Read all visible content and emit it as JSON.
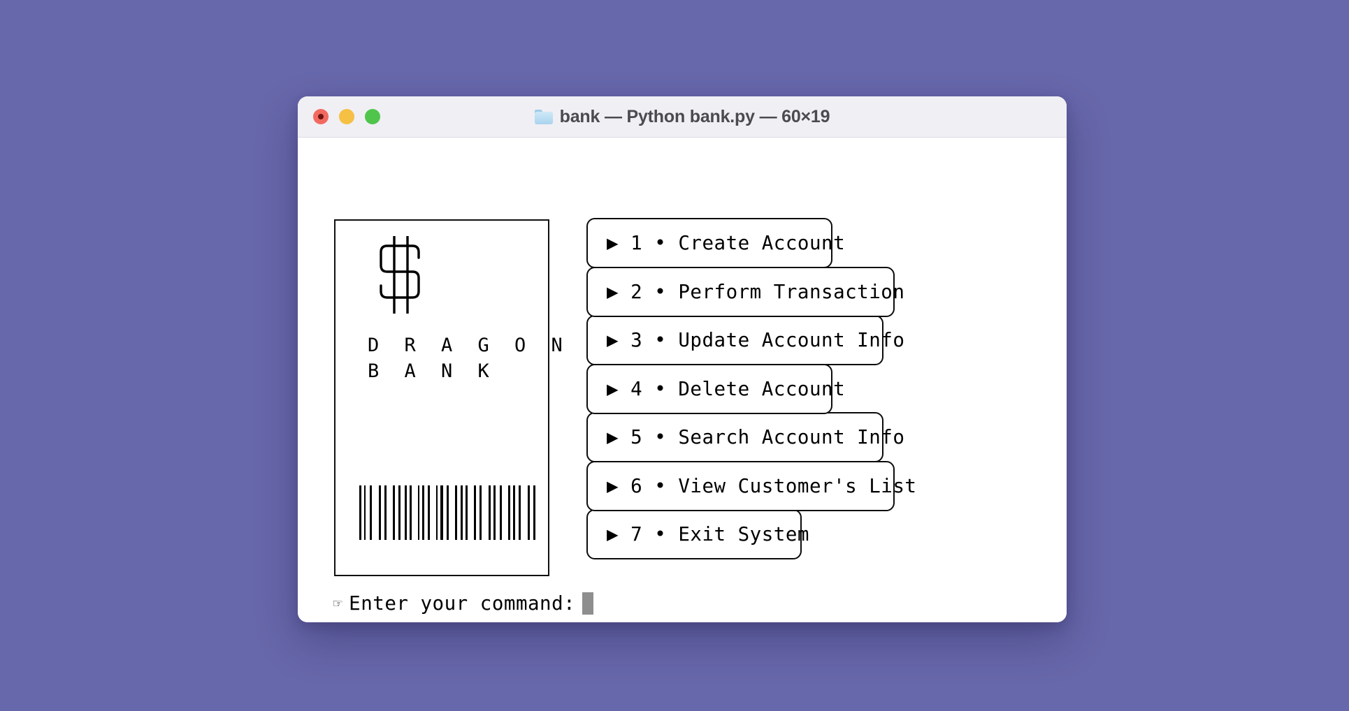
{
  "desktop": {
    "background_color": "#6767ab"
  },
  "window": {
    "title": "bank — Python bank.py — 60×19",
    "folder_icon": "folder-icon",
    "titlebar_color": "#f0eff4",
    "body_color": "#ffffff",
    "traffic_lights": [
      {
        "name": "close",
        "color": "#f2695f"
      },
      {
        "name": "minimize",
        "color": "#f5c043"
      },
      {
        "name": "maximize",
        "color": "#4fc54c"
      }
    ]
  },
  "logo_card": {
    "mark": "dollar-sign",
    "brand_line_1": "D R A G O N",
    "brand_line_2": "B A N K",
    "brand_text": "D R A G O N\nB A N K",
    "barcode": {
      "name": "barcode",
      "pattern": [
        3,
        4,
        2,
        6,
        3,
        10,
        3,
        5,
        3,
        9,
        3,
        5,
        3,
        6,
        3,
        4,
        3,
        9,
        2,
        4,
        3,
        5,
        3,
        9,
        2,
        4,
        4,
        5,
        3,
        9,
        3,
        5,
        3,
        4,
        3,
        9,
        3,
        5,
        3,
        10,
        3,
        4,
        3,
        6,
        3,
        9,
        3,
        4,
        3,
        5,
        3,
        10,
        3,
        5,
        3
      ]
    }
  },
  "menu": {
    "bullet": "•",
    "arrow": "▶",
    "items": [
      {
        "key": "1",
        "label": "Create Account",
        "text": "▶ 1 • Create Account"
      },
      {
        "key": "2",
        "label": "Perform Transaction",
        "text": "▶ 2 • Perform Transaction"
      },
      {
        "key": "3",
        "label": "Update Account Info",
        "text": "▶ 3 • Update Account Info"
      },
      {
        "key": "4",
        "label": "Delete Account",
        "text": "▶ 4 • Delete Account"
      },
      {
        "key": "5",
        "label": "Search Account Info",
        "text": "▶ 5 • Search Account Info"
      },
      {
        "key": "6",
        "label": "View Customer's List",
        "text": "▶ 6 • View Customer's List"
      },
      {
        "key": "7",
        "label": "Exit System",
        "text": "▶ 7 • Exit System"
      }
    ]
  },
  "prompt": {
    "hand_icon": "☞",
    "label": "Enter your command:",
    "value": "",
    "cursor_color": "#8e8e8e"
  }
}
